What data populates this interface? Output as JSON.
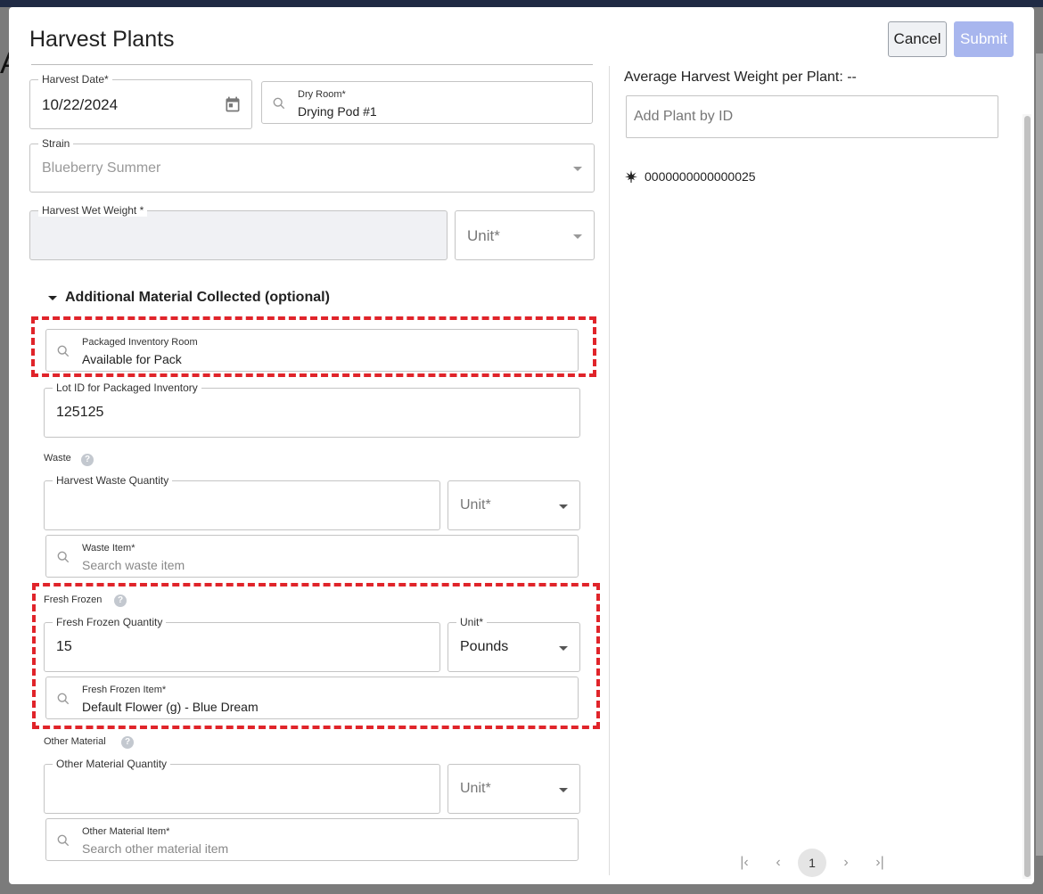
{
  "dialog": {
    "title": "Harvest Plants",
    "cancel_label": "Cancel",
    "submit_label": "Submit"
  },
  "form": {
    "harvest_date": {
      "label": "Harvest Date*",
      "value": "10/22/2024"
    },
    "dry_room": {
      "label": "Dry Room*",
      "value": "Drying Pod #1"
    },
    "strain": {
      "label": "Strain",
      "value": "Blueberry Summer"
    },
    "wet_weight": {
      "label": "Harvest Wet Weight *",
      "value": ""
    },
    "wet_weight_unit": {
      "placeholder": "Unit*"
    },
    "additional_header": "Additional Material Collected (optional)",
    "packaged_room": {
      "label": "Packaged Inventory Room",
      "value": "Available for Pack"
    },
    "lot_id": {
      "label": "Lot ID for Packaged Inventory",
      "value": "125125"
    },
    "waste": {
      "section": "Waste",
      "quantity_label": "Harvest Waste Quantity",
      "quantity_value": "",
      "unit_placeholder": "Unit*",
      "item_label": "Waste Item*",
      "item_placeholder": "Search waste item"
    },
    "fresh_frozen": {
      "section": "Fresh Frozen",
      "quantity_label": "Fresh Frozen Quantity",
      "quantity_value": "15",
      "unit_label": "Unit*",
      "unit_value": "Pounds",
      "item_label": "Fresh Frozen Item*",
      "item_value": "Default Flower (g) - Blue Dream"
    },
    "other": {
      "section": "Other Material",
      "quantity_label": "Other Material Quantity",
      "quantity_value": "",
      "unit_placeholder": "Unit*",
      "item_label": "Other Material Item*",
      "item_placeholder": "Search other material item"
    },
    "help_glyph": "?"
  },
  "plants_panel": {
    "avg_weight": "Average Harvest Weight per Plant: --",
    "add_placeholder": "Add Plant by ID",
    "plants": [
      {
        "id": "0000000000000025",
        "icon": "cannabis-leaf-icon"
      }
    ],
    "pagination": {
      "first": "|‹",
      "prev": "‹",
      "current": "1",
      "next": "›",
      "last": "›|"
    }
  },
  "background": {
    "letter": "A"
  }
}
